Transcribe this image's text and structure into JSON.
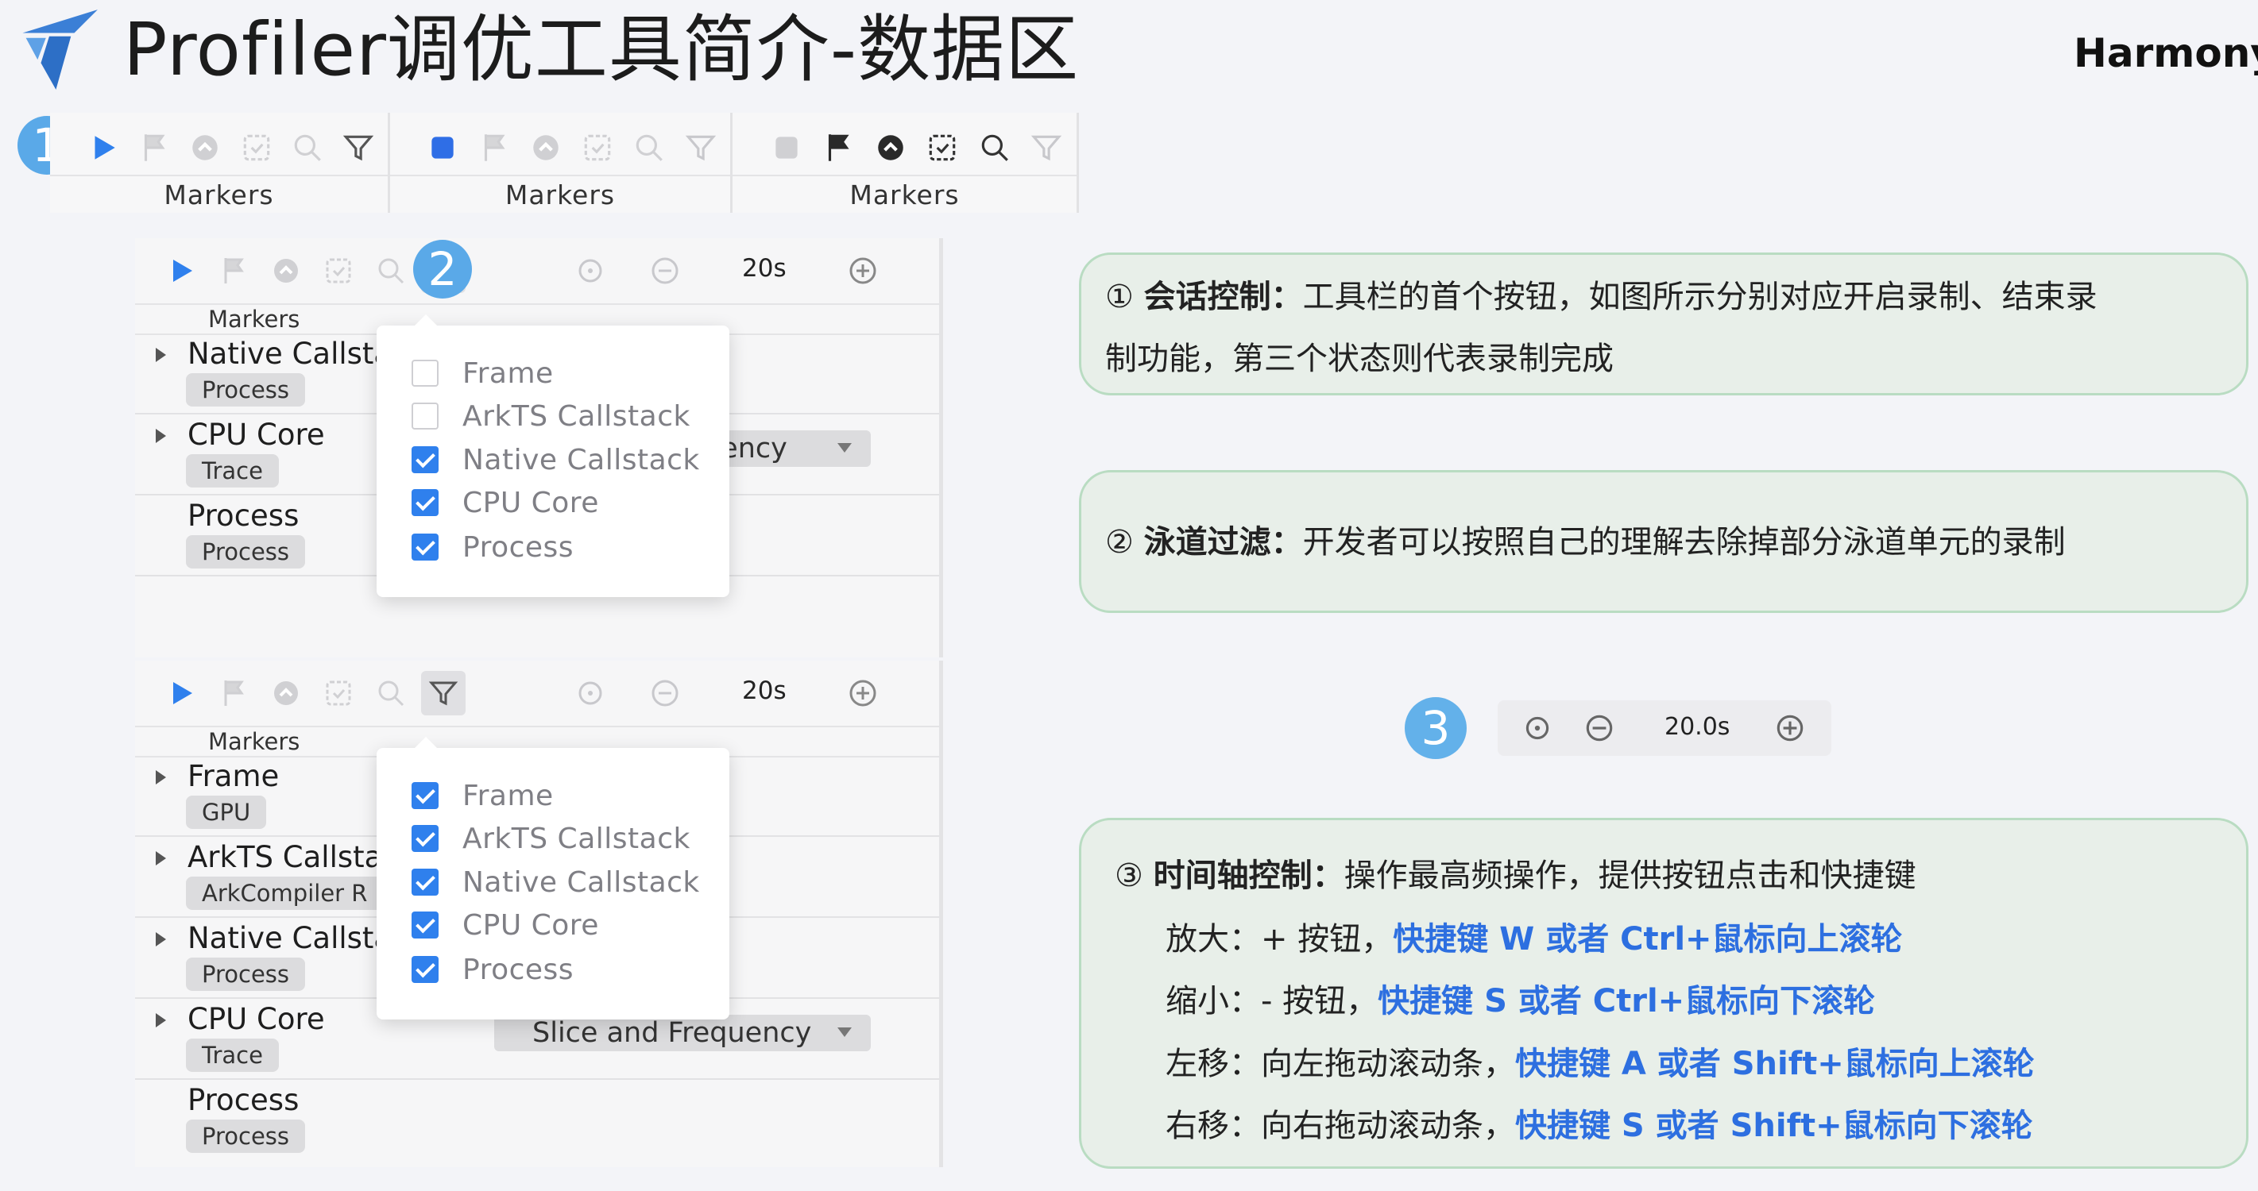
{
  "header": {
    "title": "Profiler调优工具简介-数据区",
    "brand": "HarmonyO"
  },
  "strip": {
    "badge": "1",
    "panels": [
      {
        "label": "Markers",
        "record": "play"
      },
      {
        "label": "Markers",
        "record": "stop"
      },
      {
        "label": "Markers",
        "record": "done"
      }
    ]
  },
  "panel_top": {
    "badge": "2",
    "zoom_value": "20s",
    "markers_label": "Markers",
    "lanes": [
      {
        "name": "Native Callsta",
        "chip": "Process"
      },
      {
        "name": "CPU Core",
        "chip": "Trace",
        "select": "uency"
      },
      {
        "name": "Process",
        "chip": "Process"
      }
    ],
    "filter_options": [
      {
        "label": "Frame",
        "checked": false
      },
      {
        "label": "ArkTS Callstack",
        "checked": false
      },
      {
        "label": "Native Callstack",
        "checked": true
      },
      {
        "label": "CPU Core",
        "checked": true
      },
      {
        "label": "Process",
        "checked": true
      }
    ]
  },
  "panel_bottom": {
    "zoom_value": "20s",
    "markers_label": "Markers",
    "lanes": [
      {
        "name": "Frame",
        "chip": "GPU"
      },
      {
        "name": "ArkTS Callstac",
        "chip": "ArkCompiler R"
      },
      {
        "name": "Native Callsta",
        "chip": "Process"
      },
      {
        "name": "CPU Core",
        "chip": "Trace",
        "select": "Slice and Frequency"
      },
      {
        "name": "Process",
        "chip": "Process"
      }
    ],
    "filter_options": [
      {
        "label": "Frame",
        "checked": true
      },
      {
        "label": "ArkTS Callstack",
        "checked": true
      },
      {
        "label": "Native Callstack",
        "checked": true
      },
      {
        "label": "CPU Core",
        "checked": true
      },
      {
        "label": "Process",
        "checked": true
      }
    ]
  },
  "zoom_widget": {
    "badge": "3",
    "value": "20.0s"
  },
  "notes": {
    "session": {
      "marker": "①",
      "title": "会话控制：",
      "line1": "工具栏的首个按钮，如图所示分别对应开启录制、结束录",
      "line2": "制功能，第三个状态则代表录制完成"
    },
    "lane_filter": {
      "marker": "②",
      "title": "泳道过滤：",
      "text": "开发者可以按照自己的理解去除掉部分泳道单元的录制"
    },
    "timeline": {
      "marker": "③",
      "title": "时间轴控制：",
      "intro": "操作最高频操作，提供按钮点击和快捷键",
      "rows": [
        {
          "label": "放大：",
          "plain": "+ 按钮，",
          "shortcut": "快捷键 W 或者 Ctrl+鼠标向上滚轮"
        },
        {
          "label": "缩小：",
          "plain": "- 按钮，",
          "shortcut": "快捷键 S 或者 Ctrl+鼠标向下滚轮"
        },
        {
          "label": "左移：",
          "plain": "向左拖动滚动条，",
          "shortcut": "快捷键 A 或者 Shift+鼠标向上滚轮"
        },
        {
          "label": "右移：",
          "plain": "向右拖动滚动条，",
          "shortcut": "快捷键 S 或者 Shift+鼠标向下滚轮"
        }
      ]
    }
  },
  "colors": {
    "accent_blue": "#2f80ed",
    "badge_blue": "#5aa9e8",
    "card_border": "#b9dcc2",
    "card_bg": "#e8efe9"
  }
}
